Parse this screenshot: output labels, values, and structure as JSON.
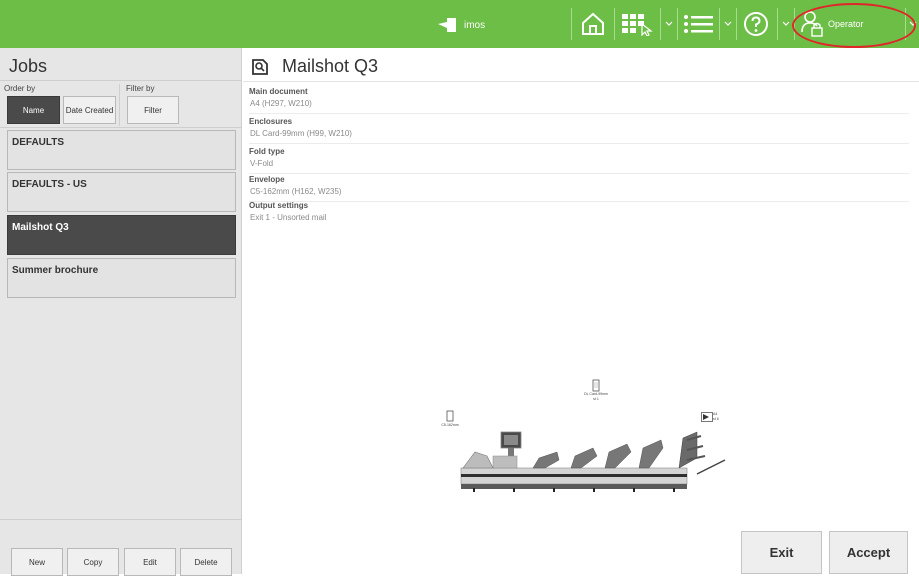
{
  "topbar": {
    "brand": "imos",
    "operator_label": "Operator",
    "colors": {
      "bar": "#6cbe46",
      "highlight": "#e0262a"
    }
  },
  "jobs_panel": {
    "title": "Jobs",
    "order_by_label": "Order by",
    "filter_by_label": "Filter by",
    "order_options": [
      "Name",
      "Date Created"
    ],
    "active_order": "Name",
    "filter_button": "Filter",
    "items": [
      {
        "name": "DEFAULTS",
        "selected": false
      },
      {
        "name": "DEFAULTS - US",
        "selected": false
      },
      {
        "name": "Mailshot Q3",
        "selected": true
      },
      {
        "name": "Summer brochure",
        "selected": false
      }
    ],
    "actions": [
      "New",
      "Copy",
      "Edit",
      "Delete"
    ]
  },
  "job_detail": {
    "title": "Mailshot Q3",
    "fields": [
      {
        "label": "Main document",
        "value": "A4 (H297, W210)"
      },
      {
        "label": "Enclosures",
        "value": "DL Card-99mm (H99, W210)"
      },
      {
        "label": "Fold type",
        "value": "V-Fold"
      },
      {
        "label": "Envelope",
        "value": "C5-162mm (H162, W235)"
      },
      {
        "label": "Output settings",
        "value": "Exit 1 - Unsorted mail"
      }
    ],
    "machine_labels": {
      "envelope": "C5-162mm",
      "enclosure": "DL Card-99mm",
      "enclosure_sub": "st 1",
      "document": "A4",
      "document_sub": "st 6"
    },
    "buttons": {
      "exit": "Exit",
      "accept": "Accept"
    }
  }
}
